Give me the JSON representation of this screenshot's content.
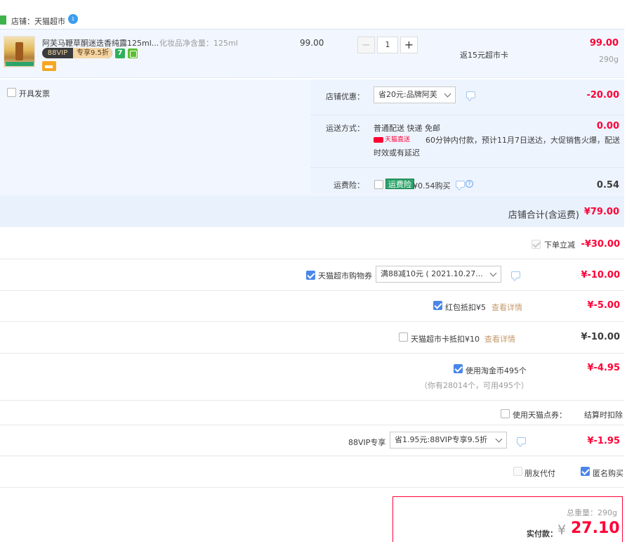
{
  "store": {
    "name": "店铺：天猫超市",
    "badge": "1"
  },
  "item": {
    "title": "阿芙马鞭草酮迷迭香纯露125ml...",
    "sku": "化妆品净含量：125ml",
    "vip_left": "88VIP",
    "vip_right": "专享9.5折",
    "badge_7": "7",
    "unit_price": "99.00",
    "quantity": "1",
    "minus": "−",
    "plus": "+",
    "rebate": "返15元超市卡",
    "subtotal": "99.00",
    "weight": "290g"
  },
  "invoice": {
    "label": "开具发票"
  },
  "store_discount": {
    "label": "店铺优惠：",
    "selected": "省20元:品牌阿芙",
    "amount": "-20.00"
  },
  "shipping": {
    "label": "运送方式：",
    "method": "普通配送 快递 免邮",
    "amount": "0.00",
    "tmall_tag": "天猫直送",
    "note_line1": "60分钟内付款，预计11月7日送达，大促销售火爆，配送",
    "note_line2": "时效或有延迟"
  },
  "freight_insurance": {
    "label": "运费险：",
    "tag": "运费险",
    "desc": "¥0.54购买",
    "help": "?",
    "amount": "0.54"
  },
  "store_total": {
    "label": "店铺合计(含运费)",
    "amount": "¥79.00"
  },
  "order_discount": {
    "label": "下单立减",
    "amount": "-¥30.00"
  },
  "coupon": {
    "label": "天猫超市购物券",
    "selected": "满88减10元 ( 2021.10.27...",
    "amount": "¥-10.00"
  },
  "red_packet": {
    "label": "红包抵扣¥5",
    "link": "查看详情",
    "amount": "¥-5.00"
  },
  "supermarket_card": {
    "label": "天猫超市卡抵扣¥10",
    "link": "查看详情",
    "amount": "¥-10.00"
  },
  "taojinbi": {
    "label": "使用淘金币495个",
    "sub": "（你有28014个，可用495个）",
    "amount": "¥-4.95"
  },
  "tmall_points": {
    "label": "使用天猫点券：",
    "value": "结算时扣除"
  },
  "vip88": {
    "label": "88VIP专享",
    "selected": "省1.95元:88VIP专享9.5折",
    "amount": "¥-1.95"
  },
  "friend_pay": {
    "label": "朋友代付"
  },
  "anonymous": {
    "label": "匿名购买"
  },
  "final": {
    "weight": "总重量：290g",
    "label": "实付款：",
    "currency": "¥",
    "amount": "27.10"
  },
  "colors": {
    "accent_red": "#ff0036",
    "checkbox_blue": "#4a86e8",
    "panel_blue": "#f2f7ff"
  }
}
